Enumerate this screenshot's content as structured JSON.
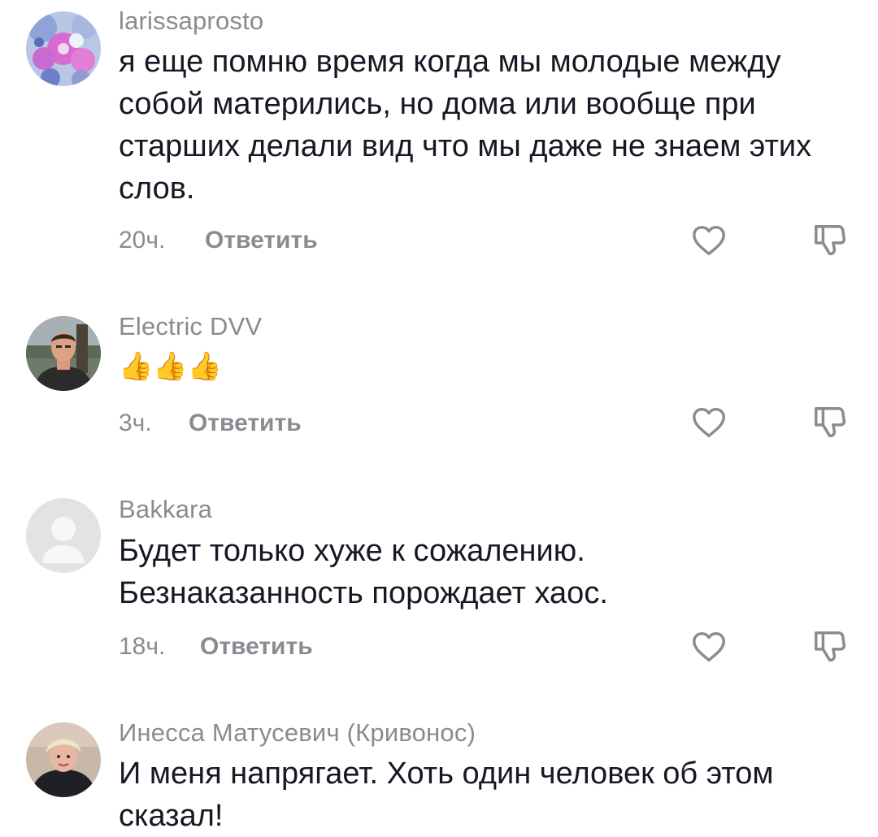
{
  "comments": [
    {
      "username": "larissaprosto",
      "text": "я еще помню время когда мы молодые между собой матерились, но дома или вообще при старших делали вид что мы даже не знаем этих слов.",
      "time": "20ч.",
      "reply_label": "Ответить",
      "avatar": "flowers-avatar"
    },
    {
      "username": "Electric DVV",
      "text": "👍👍👍",
      "time": "3ч.",
      "reply_label": "Ответить",
      "avatar": "man-photo-avatar"
    },
    {
      "username": "Bakkara",
      "text": "Будет только хуже к сожалению. Безнаказанность порождает хаос.",
      "time": "18ч.",
      "reply_label": "Ответить",
      "avatar": "default-avatar"
    },
    {
      "username": "Инесса Матусевич (Кривонос)",
      "text": "И меня напрягает. Хоть один человек об этом сказал!",
      "avatar": "woman-photo-avatar"
    }
  ],
  "icons": {
    "like": "heart-outline-icon",
    "dislike": "thumbs-down-outline-icon"
  },
  "colors": {
    "primary_text": "#161823",
    "secondary_text": "#8a8b91",
    "background": "#ffffff"
  }
}
